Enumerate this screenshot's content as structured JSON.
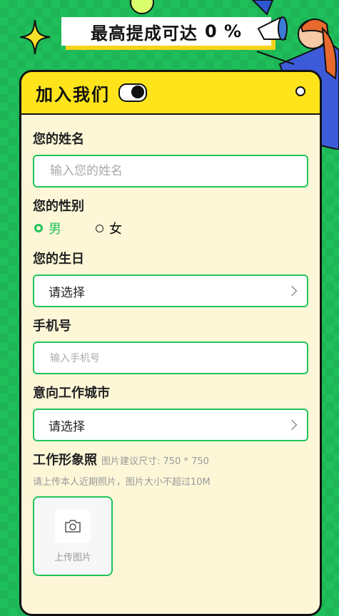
{
  "banner": {
    "text": "最高提成可达",
    "percent": "0 %"
  },
  "card": {
    "title": "加入我们",
    "name": {
      "label": "您的姓名",
      "placeholder": "输入您的姓名"
    },
    "gender": {
      "label": "您的性别",
      "options": [
        "男",
        "女"
      ],
      "selected": "男"
    },
    "birthday": {
      "label": "您的生日",
      "value": "请选择"
    },
    "phone": {
      "label": "手机号",
      "placeholder": "输入手机号"
    },
    "city": {
      "label": "意向工作城市",
      "value": "请选择"
    },
    "photo": {
      "label": "工作形象照",
      "size_hint": "图片建议尺寸: 750 * 750",
      "hint": "请上传本人近期照片，图片大小不超过10M",
      "upload_label": "上传图片"
    }
  },
  "colors": {
    "accent": "#21c35c",
    "header": "#ffe41c",
    "background": "#1fbf5b",
    "card": "#fdf7d8"
  }
}
